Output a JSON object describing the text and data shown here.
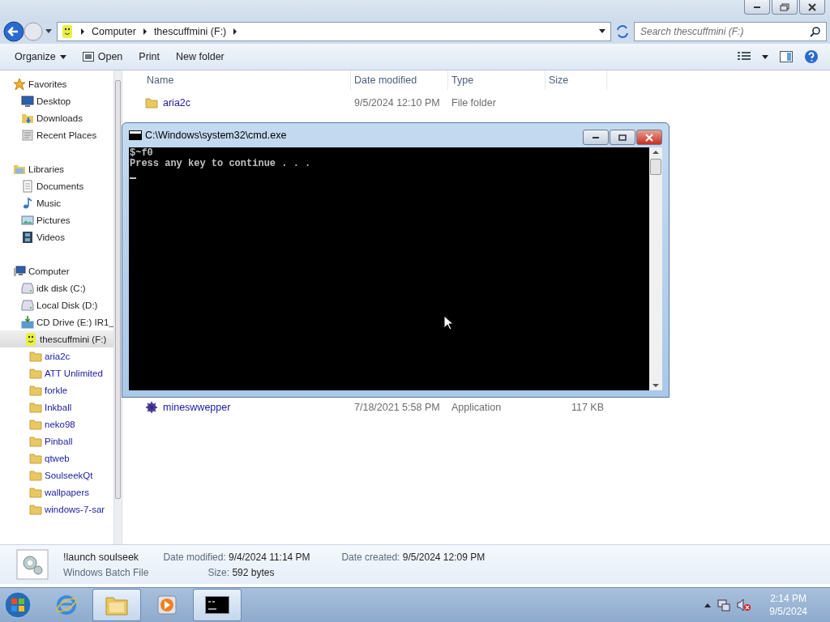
{
  "address": {
    "breadcrumbs": [
      "Computer",
      "thescuffmini (F:)"
    ]
  },
  "search": {
    "placeholder": "Search thescuffmini (F:)"
  },
  "toolbar": [
    {
      "label": "Organize",
      "kind": "menu"
    },
    {
      "label": "Open",
      "kind": "icon"
    },
    {
      "label": "Print",
      "kind": "plain"
    },
    {
      "label": "New folder",
      "kind": "plain"
    }
  ],
  "sidebar": [
    {
      "label": "Favorites",
      "kind": "favorites",
      "selected": false,
      "children": [
        {
          "label": "Desktop",
          "kind": "desktop",
          "selected": false
        },
        {
          "label": "Downloads",
          "kind": "downloads",
          "selected": false
        },
        {
          "label": "Recent Places",
          "kind": "recent",
          "selected": false
        }
      ]
    },
    {
      "label": "Libraries",
      "kind": "libraries",
      "selected": false,
      "children": [
        {
          "label": "Documents",
          "kind": "documents",
          "selected": false
        },
        {
          "label": "Music",
          "kind": "music",
          "selected": false
        },
        {
          "label": "Pictures",
          "kind": "pictures",
          "selected": false
        },
        {
          "label": "Videos",
          "kind": "videos",
          "selected": false
        }
      ]
    },
    {
      "label": "Computer",
      "kind": "computer",
      "selected": false,
      "children": [
        {
          "label": "idk disk (C:)",
          "kind": "disk",
          "selected": false
        },
        {
          "label": "Local Disk (D:)",
          "kind": "disk",
          "selected": false
        },
        {
          "label": "CD Drive (E:) IR1_",
          "kind": "cd",
          "selected": false
        },
        {
          "label": "thescuffmini (F:)",
          "kind": "usb",
          "selected": true,
          "children": [
            {
              "label": "aria2c",
              "kind": "folder",
              "selected": false
            },
            {
              "label": "ATT Unlimited",
              "kind": "folder",
              "selected": false
            },
            {
              "label": "forkle",
              "kind": "folder",
              "selected": false
            },
            {
              "label": "Inkball",
              "kind": "folder",
              "selected": false
            },
            {
              "label": "neko98",
              "kind": "folder",
              "selected": false
            },
            {
              "label": "Pinball",
              "kind": "folder",
              "selected": false
            },
            {
              "label": "qtweb",
              "kind": "folder",
              "selected": false
            },
            {
              "label": "SoulseekQt",
              "kind": "folder",
              "selected": false
            },
            {
              "label": "wallpapers",
              "kind": "folder",
              "selected": false
            },
            {
              "label": "windows-7-sar",
              "kind": "folder",
              "selected": false
            }
          ]
        }
      ]
    }
  ],
  "columns": [
    "Name",
    "Date modified",
    "Type",
    "Size"
  ],
  "rows": [
    {
      "kind": "folder",
      "name": "aria2c",
      "date": "9/5/2024 12:10 PM",
      "type": "File folder"
    },
    {
      "kind": "app",
      "name": "mineswwepper",
      "date": "7/18/2021 5:58 PM",
      "type": "Application",
      "size": "117 KB"
    }
  ],
  "details": {
    "name": "!launch soulseek",
    "type": "Windows Batch File",
    "fields": [
      {
        "label": "Date modified:",
        "value": "9/4/2024 11:14 PM"
      },
      {
        "label": "Size:",
        "value": "592 bytes"
      },
      {
        "label": "Date created:",
        "value": "9/5/2024 12:09 PM"
      }
    ]
  },
  "console": {
    "title": "C:\\Windows\\system32\\cmd.exe",
    "lines": [
      "$~f0",
      "Press any key to continue . . ."
    ]
  },
  "taskbar": [
    {
      "kind": "browser",
      "selected": false
    },
    {
      "kind": "explorer",
      "selected": true
    },
    {
      "kind": "media",
      "selected": false
    },
    {
      "kind": "console",
      "selected": true
    }
  ],
  "clock": {
    "time": "2:14 PM",
    "date": "9/5/2024"
  }
}
